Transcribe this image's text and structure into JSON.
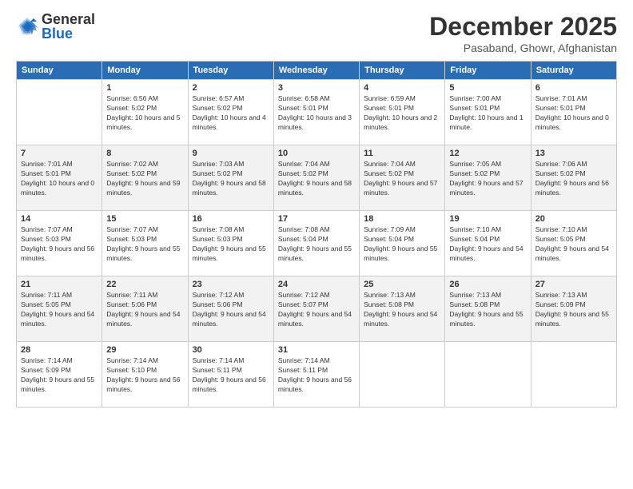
{
  "header": {
    "logo_general": "General",
    "logo_blue": "Blue",
    "month_title": "December 2025",
    "location": "Pasaband, Ghowr, Afghanistan"
  },
  "weekdays": [
    "Sunday",
    "Monday",
    "Tuesday",
    "Wednesday",
    "Thursday",
    "Friday",
    "Saturday"
  ],
  "weeks": [
    [
      {
        "day": "",
        "sunrise": "",
        "sunset": "",
        "daylight": ""
      },
      {
        "day": "1",
        "sunrise": "Sunrise: 6:56 AM",
        "sunset": "Sunset: 5:02 PM",
        "daylight": "Daylight: 10 hours and 5 minutes."
      },
      {
        "day": "2",
        "sunrise": "Sunrise: 6:57 AM",
        "sunset": "Sunset: 5:02 PM",
        "daylight": "Daylight: 10 hours and 4 minutes."
      },
      {
        "day": "3",
        "sunrise": "Sunrise: 6:58 AM",
        "sunset": "Sunset: 5:01 PM",
        "daylight": "Daylight: 10 hours and 3 minutes."
      },
      {
        "day": "4",
        "sunrise": "Sunrise: 6:59 AM",
        "sunset": "Sunset: 5:01 PM",
        "daylight": "Daylight: 10 hours and 2 minutes."
      },
      {
        "day": "5",
        "sunrise": "Sunrise: 7:00 AM",
        "sunset": "Sunset: 5:01 PM",
        "daylight": "Daylight: 10 hours and 1 minute."
      },
      {
        "day": "6",
        "sunrise": "Sunrise: 7:01 AM",
        "sunset": "Sunset: 5:01 PM",
        "daylight": "Daylight: 10 hours and 0 minutes."
      }
    ],
    [
      {
        "day": "7",
        "sunrise": "Sunrise: 7:01 AM",
        "sunset": "Sunset: 5:01 PM",
        "daylight": "Daylight: 10 hours and 0 minutes."
      },
      {
        "day": "8",
        "sunrise": "Sunrise: 7:02 AM",
        "sunset": "Sunset: 5:02 PM",
        "daylight": "Daylight: 9 hours and 59 minutes."
      },
      {
        "day": "9",
        "sunrise": "Sunrise: 7:03 AM",
        "sunset": "Sunset: 5:02 PM",
        "daylight": "Daylight: 9 hours and 58 minutes."
      },
      {
        "day": "10",
        "sunrise": "Sunrise: 7:04 AM",
        "sunset": "Sunset: 5:02 PM",
        "daylight": "Daylight: 9 hours and 58 minutes."
      },
      {
        "day": "11",
        "sunrise": "Sunrise: 7:04 AM",
        "sunset": "Sunset: 5:02 PM",
        "daylight": "Daylight: 9 hours and 57 minutes."
      },
      {
        "day": "12",
        "sunrise": "Sunrise: 7:05 AM",
        "sunset": "Sunset: 5:02 PM",
        "daylight": "Daylight: 9 hours and 57 minutes."
      },
      {
        "day": "13",
        "sunrise": "Sunrise: 7:06 AM",
        "sunset": "Sunset: 5:02 PM",
        "daylight": "Daylight: 9 hours and 56 minutes."
      }
    ],
    [
      {
        "day": "14",
        "sunrise": "Sunrise: 7:07 AM",
        "sunset": "Sunset: 5:03 PM",
        "daylight": "Daylight: 9 hours and 56 minutes."
      },
      {
        "day": "15",
        "sunrise": "Sunrise: 7:07 AM",
        "sunset": "Sunset: 5:03 PM",
        "daylight": "Daylight: 9 hours and 55 minutes."
      },
      {
        "day": "16",
        "sunrise": "Sunrise: 7:08 AM",
        "sunset": "Sunset: 5:03 PM",
        "daylight": "Daylight: 9 hours and 55 minutes."
      },
      {
        "day": "17",
        "sunrise": "Sunrise: 7:08 AM",
        "sunset": "Sunset: 5:04 PM",
        "daylight": "Daylight: 9 hours and 55 minutes."
      },
      {
        "day": "18",
        "sunrise": "Sunrise: 7:09 AM",
        "sunset": "Sunset: 5:04 PM",
        "daylight": "Daylight: 9 hours and 55 minutes."
      },
      {
        "day": "19",
        "sunrise": "Sunrise: 7:10 AM",
        "sunset": "Sunset: 5:04 PM",
        "daylight": "Daylight: 9 hours and 54 minutes."
      },
      {
        "day": "20",
        "sunrise": "Sunrise: 7:10 AM",
        "sunset": "Sunset: 5:05 PM",
        "daylight": "Daylight: 9 hours and 54 minutes."
      }
    ],
    [
      {
        "day": "21",
        "sunrise": "Sunrise: 7:11 AM",
        "sunset": "Sunset: 5:05 PM",
        "daylight": "Daylight: 9 hours and 54 minutes."
      },
      {
        "day": "22",
        "sunrise": "Sunrise: 7:11 AM",
        "sunset": "Sunset: 5:06 PM",
        "daylight": "Daylight: 9 hours and 54 minutes."
      },
      {
        "day": "23",
        "sunrise": "Sunrise: 7:12 AM",
        "sunset": "Sunset: 5:06 PM",
        "daylight": "Daylight: 9 hours and 54 minutes."
      },
      {
        "day": "24",
        "sunrise": "Sunrise: 7:12 AM",
        "sunset": "Sunset: 5:07 PM",
        "daylight": "Daylight: 9 hours and 54 minutes."
      },
      {
        "day": "25",
        "sunrise": "Sunrise: 7:13 AM",
        "sunset": "Sunset: 5:08 PM",
        "daylight": "Daylight: 9 hours and 54 minutes."
      },
      {
        "day": "26",
        "sunrise": "Sunrise: 7:13 AM",
        "sunset": "Sunset: 5:08 PM",
        "daylight": "Daylight: 9 hours and 55 minutes."
      },
      {
        "day": "27",
        "sunrise": "Sunrise: 7:13 AM",
        "sunset": "Sunset: 5:09 PM",
        "daylight": "Daylight: 9 hours and 55 minutes."
      }
    ],
    [
      {
        "day": "28",
        "sunrise": "Sunrise: 7:14 AM",
        "sunset": "Sunset: 5:09 PM",
        "daylight": "Daylight: 9 hours and 55 minutes."
      },
      {
        "day": "29",
        "sunrise": "Sunrise: 7:14 AM",
        "sunset": "Sunset: 5:10 PM",
        "daylight": "Daylight: 9 hours and 56 minutes."
      },
      {
        "day": "30",
        "sunrise": "Sunrise: 7:14 AM",
        "sunset": "Sunset: 5:11 PM",
        "daylight": "Daylight: 9 hours and 56 minutes."
      },
      {
        "day": "31",
        "sunrise": "Sunrise: 7:14 AM",
        "sunset": "Sunset: 5:11 PM",
        "daylight": "Daylight: 9 hours and 56 minutes."
      },
      {
        "day": "",
        "sunrise": "",
        "sunset": "",
        "daylight": ""
      },
      {
        "day": "",
        "sunrise": "",
        "sunset": "",
        "daylight": ""
      },
      {
        "day": "",
        "sunrise": "",
        "sunset": "",
        "daylight": ""
      }
    ]
  ]
}
